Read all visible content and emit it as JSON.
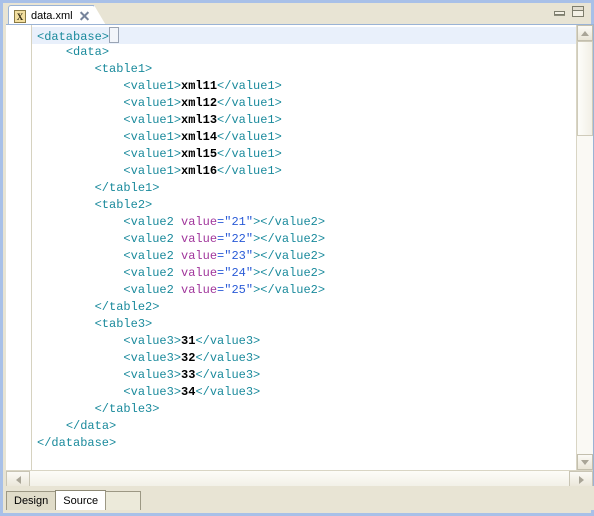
{
  "window": {
    "title": "data.xml",
    "controls": [
      {
        "name": "minimize",
        "label": "Minimize"
      },
      {
        "name": "maximize",
        "label": "Maximize"
      }
    ]
  },
  "editor_tab": {
    "icon": "xml-file-icon",
    "icon_glyph": "X",
    "label": "data.xml",
    "close_label": "Close"
  },
  "colors": {
    "tag": "#1a8a9c",
    "text": "#000000",
    "attribute_name": "#a0359b",
    "attribute_value": "#2a5bd7",
    "current_line_highlight": "#e9f0fb",
    "window_frame": "#a8c0e8",
    "chrome": "#e8e4d4"
  },
  "code_lines": [
    {
      "indent": 0,
      "current": true,
      "parts": [
        {
          "cls": "tg",
          "t": "<database>"
        },
        {
          "cls": "caret",
          "t": ""
        }
      ]
    },
    {
      "indent": 1,
      "current": false,
      "parts": [
        {
          "cls": "tg",
          "t": "<data>"
        }
      ]
    },
    {
      "indent": 2,
      "current": false,
      "parts": [
        {
          "cls": "tg",
          "t": "<table1>"
        }
      ]
    },
    {
      "indent": 3,
      "current": false,
      "parts": [
        {
          "cls": "tg",
          "t": "<value1>"
        },
        {
          "cls": "tx",
          "t": "xml11"
        },
        {
          "cls": "tg",
          "t": "</value1>"
        }
      ]
    },
    {
      "indent": 3,
      "current": false,
      "parts": [
        {
          "cls": "tg",
          "t": "<value1>"
        },
        {
          "cls": "tx",
          "t": "xml12"
        },
        {
          "cls": "tg",
          "t": "</value1>"
        }
      ]
    },
    {
      "indent": 3,
      "current": false,
      "parts": [
        {
          "cls": "tg",
          "t": "<value1>"
        },
        {
          "cls": "tx",
          "t": "xml13"
        },
        {
          "cls": "tg",
          "t": "</value1>"
        }
      ]
    },
    {
      "indent": 3,
      "current": false,
      "parts": [
        {
          "cls": "tg",
          "t": "<value1>"
        },
        {
          "cls": "tx",
          "t": "xml14"
        },
        {
          "cls": "tg",
          "t": "</value1>"
        }
      ]
    },
    {
      "indent": 3,
      "current": false,
      "parts": [
        {
          "cls": "tg",
          "t": "<value1>"
        },
        {
          "cls": "tx",
          "t": "xml15"
        },
        {
          "cls": "tg",
          "t": "</value1>"
        }
      ]
    },
    {
      "indent": 3,
      "current": false,
      "parts": [
        {
          "cls": "tg",
          "t": "<value1>"
        },
        {
          "cls": "tx",
          "t": "xml16"
        },
        {
          "cls": "tg",
          "t": "</value1>"
        }
      ]
    },
    {
      "indent": 2,
      "current": false,
      "parts": [
        {
          "cls": "tg",
          "t": "</table1>"
        }
      ]
    },
    {
      "indent": 2,
      "current": false,
      "parts": [
        {
          "cls": "tg",
          "t": "<table2>"
        }
      ]
    },
    {
      "indent": 3,
      "current": false,
      "parts": [
        {
          "cls": "tg",
          "t": "<value2 "
        },
        {
          "cls": "at",
          "t": "value"
        },
        {
          "cls": "av",
          "t": "=\"21\""
        },
        {
          "cls": "tg",
          "t": "></value2>"
        }
      ]
    },
    {
      "indent": 3,
      "current": false,
      "parts": [
        {
          "cls": "tg",
          "t": "<value2 "
        },
        {
          "cls": "at",
          "t": "value"
        },
        {
          "cls": "av",
          "t": "=\"22\""
        },
        {
          "cls": "tg",
          "t": "></value2>"
        }
      ]
    },
    {
      "indent": 3,
      "current": false,
      "parts": [
        {
          "cls": "tg",
          "t": "<value2 "
        },
        {
          "cls": "at",
          "t": "value"
        },
        {
          "cls": "av",
          "t": "=\"23\""
        },
        {
          "cls": "tg",
          "t": "></value2>"
        }
      ]
    },
    {
      "indent": 3,
      "current": false,
      "parts": [
        {
          "cls": "tg",
          "t": "<value2 "
        },
        {
          "cls": "at",
          "t": "value"
        },
        {
          "cls": "av",
          "t": "=\"24\""
        },
        {
          "cls": "tg",
          "t": "></value2>"
        }
      ]
    },
    {
      "indent": 3,
      "current": false,
      "parts": [
        {
          "cls": "tg",
          "t": "<value2 "
        },
        {
          "cls": "at",
          "t": "value"
        },
        {
          "cls": "av",
          "t": "=\"25\""
        },
        {
          "cls": "tg",
          "t": "></value2>"
        }
      ]
    },
    {
      "indent": 2,
      "current": false,
      "parts": [
        {
          "cls": "tg",
          "t": "</table2>"
        }
      ]
    },
    {
      "indent": 2,
      "current": false,
      "parts": [
        {
          "cls": "tg",
          "t": "<table3>"
        }
      ]
    },
    {
      "indent": 3,
      "current": false,
      "parts": [
        {
          "cls": "tg",
          "t": "<value3>"
        },
        {
          "cls": "tx",
          "t": "31"
        },
        {
          "cls": "tg",
          "t": "</value3>"
        }
      ]
    },
    {
      "indent": 3,
      "current": false,
      "parts": [
        {
          "cls": "tg",
          "t": "<value3>"
        },
        {
          "cls": "tx",
          "t": "32"
        },
        {
          "cls": "tg",
          "t": "</value3>"
        }
      ]
    },
    {
      "indent": 3,
      "current": false,
      "parts": [
        {
          "cls": "tg",
          "t": "<value3>"
        },
        {
          "cls": "tx",
          "t": "33"
        },
        {
          "cls": "tg",
          "t": "</value3>"
        }
      ]
    },
    {
      "indent": 3,
      "current": false,
      "parts": [
        {
          "cls": "tg",
          "t": "<value3>"
        },
        {
          "cls": "tx",
          "t": "34"
        },
        {
          "cls": "tg",
          "t": "</value3>"
        }
      ]
    },
    {
      "indent": 2,
      "current": false,
      "parts": [
        {
          "cls": "tg",
          "t": "</table3>"
        }
      ]
    },
    {
      "indent": 1,
      "current": false,
      "parts": [
        {
          "cls": "tg",
          "t": "</data>"
        }
      ]
    },
    {
      "indent": 0,
      "current": false,
      "parts": [
        {
          "cls": "tg",
          "t": "</database>"
        }
      ]
    }
  ],
  "scrollbars": {
    "vertical": {
      "up": "scroll-up",
      "down": "scroll-down"
    },
    "horizontal": {
      "left": "scroll-left",
      "right": "scroll-right"
    }
  },
  "bottom_tabs": [
    {
      "label": "Design",
      "active": false
    },
    {
      "label": "Source",
      "active": true
    }
  ]
}
